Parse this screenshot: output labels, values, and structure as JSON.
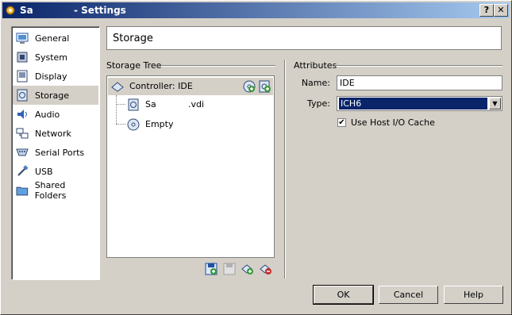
{
  "window": {
    "title_name": "Sa",
    "title_suffix": "- Settings",
    "help_glyph": "?",
    "close_glyph": "✕"
  },
  "sidebar": {
    "items": [
      {
        "label": "General",
        "icon": "general-icon"
      },
      {
        "label": "System",
        "icon": "system-icon"
      },
      {
        "label": "Display",
        "icon": "display-icon"
      },
      {
        "label": "Storage",
        "icon": "storage-icon",
        "selected": true
      },
      {
        "label": "Audio",
        "icon": "audio-icon"
      },
      {
        "label": "Network",
        "icon": "network-icon"
      },
      {
        "label": "Serial Ports",
        "icon": "serial-port-icon"
      },
      {
        "label": "USB",
        "icon": "usb-icon"
      },
      {
        "label": "Shared Folders",
        "icon": "shared-folder-icon"
      }
    ]
  },
  "page": {
    "title": "Storage"
  },
  "storage_tree": {
    "label": "Storage Tree",
    "controller": "Controller: IDE",
    "disk_name": "Sa",
    "disk_ext": ".vdi",
    "cdrom": "Empty"
  },
  "attributes": {
    "label": "Attributes",
    "name_label": "Name:",
    "name_value": "IDE",
    "type_label": "Type:",
    "type_value": "ICH6",
    "host_cache_label": "Use Host I/O Cache",
    "host_cache_checked": true,
    "check_glyph": "✔"
  },
  "buttons": {
    "ok": "OK",
    "cancel": "Cancel",
    "help": "Help"
  },
  "colors": {
    "selection": "#0a246a",
    "titlebar_start": "#0a246a",
    "titlebar_end": "#a6caf0",
    "face": "#d4d0c8"
  }
}
